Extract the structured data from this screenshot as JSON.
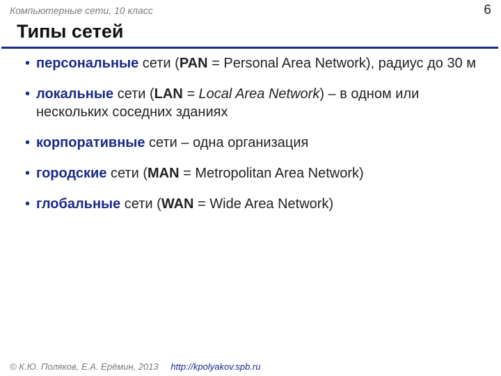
{
  "header": {
    "course": "Компьютерные сети, 10 класс",
    "page": "6"
  },
  "title": "Типы сетей",
  "items": [
    {
      "bold": "персональные",
      "tail1": " сети (",
      "abbr": "PAN",
      "tail2": " = Personal Area Network), радиус до 30 м",
      "abbr_italic": false
    },
    {
      "bold": "локальные",
      "tail1": " сети (",
      "abbr": "LAN",
      "expansion_italic": " = Local Area Network",
      "tail2": ") – в одном или нескольких соседних зданиях",
      "abbr_italic": true
    },
    {
      "bold": "корпоративные",
      "tail1": " сети – одна организация",
      "abbr": "",
      "tail2": "",
      "abbr_italic": false
    },
    {
      "bold": "городские",
      "tail1": " сети (",
      "abbr": "MAN",
      "tail2": " = Metropolitan Area Network)",
      "abbr_italic": false
    },
    {
      "bold": "глобальные",
      "tail1": " сети (",
      "abbr": "WAN",
      "tail2": " = Wide Area Network)",
      "abbr_italic": false
    }
  ],
  "footer": {
    "copyright": "© К.Ю. Поляков, Е.А. Ерёмин, 2013",
    "url": "http://kpolyakov.spb.ru"
  }
}
